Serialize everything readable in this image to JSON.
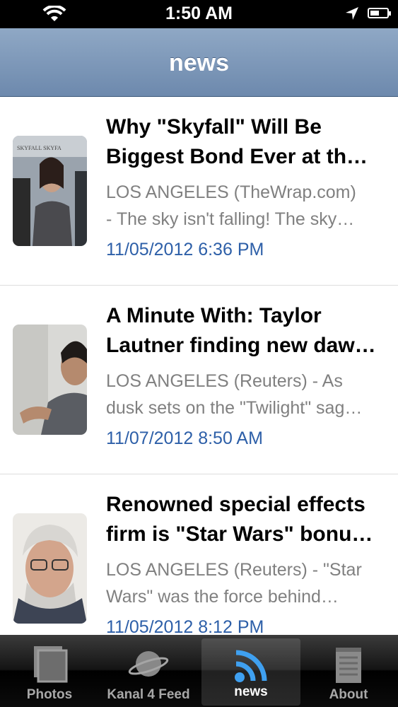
{
  "status_bar": {
    "time": "1:50 AM"
  },
  "nav": {
    "title": "news"
  },
  "articles": [
    {
      "title": "Why \"Skyfall\" Will Be\nBiggest Bond Ever at th…",
      "summary": "LOS ANGELES (TheWrap.com)\n- The sky isn't falling! The sky…",
      "date": "11/05/2012 6:36 PM"
    },
    {
      "title": "A Minute With: Taylor\nLautner finding new daw…",
      "summary": "LOS ANGELES (Reuters) - As\ndusk sets on the \"Twilight\" sag…",
      "date": "11/07/2012 8:50 AM"
    },
    {
      "title": "Renowned special effects\nfirm is \"Star Wars\" bonu…",
      "summary": "LOS ANGELES (Reuters) - \"Star\nWars\" was the force behind…",
      "date": "11/05/2012 8:12 PM"
    }
  ],
  "tabs": [
    {
      "label": "Photos",
      "icon": "photos-icon"
    },
    {
      "label": "Kanal 4 Feed",
      "icon": "planet-icon"
    },
    {
      "label": "news",
      "icon": "rss-icon",
      "active": true
    },
    {
      "label": "About",
      "icon": "notepad-icon"
    }
  ],
  "colors": {
    "nav": "#7d97b9",
    "date": "#2d5fa8",
    "summary": "#808080"
  }
}
